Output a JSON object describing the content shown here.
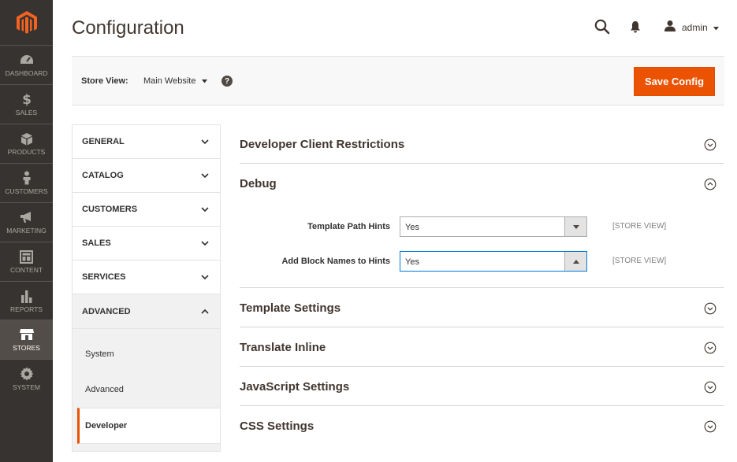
{
  "page": {
    "title": "Configuration"
  },
  "header": {
    "user": "admin"
  },
  "nav": {
    "items": [
      {
        "label": "DASHBOARD",
        "icon": "dashboard-icon"
      },
      {
        "label": "SALES",
        "icon": "dollar-icon"
      },
      {
        "label": "PRODUCTS",
        "icon": "box-icon"
      },
      {
        "label": "CUSTOMERS",
        "icon": "person-icon"
      },
      {
        "label": "MARKETING",
        "icon": "megaphone-icon"
      },
      {
        "label": "CONTENT",
        "icon": "layout-icon"
      },
      {
        "label": "REPORTS",
        "icon": "bar-chart-icon"
      },
      {
        "label": "STORES",
        "icon": "store-icon"
      },
      {
        "label": "SYSTEM",
        "icon": "gear-icon"
      }
    ]
  },
  "store_view": {
    "label": "Store View:",
    "value": "Main Website"
  },
  "actions": {
    "save_label": "Save Config"
  },
  "tabs": {
    "items": [
      {
        "label": "GENERAL"
      },
      {
        "label": "CATALOG"
      },
      {
        "label": "CUSTOMERS"
      },
      {
        "label": "SALES"
      },
      {
        "label": "SERVICES"
      },
      {
        "label": "ADVANCED"
      }
    ],
    "subitems": [
      {
        "label": "System"
      },
      {
        "label": "Advanced"
      },
      {
        "label": "Developer"
      }
    ]
  },
  "sections": {
    "client_restrictions": "Developer Client Restrictions",
    "debug": "Debug",
    "template_settings": "Template Settings",
    "translate_inline": "Translate Inline",
    "javascript_settings": "JavaScript Settings",
    "css_settings": "CSS Settings"
  },
  "debug": {
    "fields": [
      {
        "label": "Template Path Hints",
        "value": "Yes",
        "scope": "[STORE VIEW]"
      },
      {
        "label": "Add Block Names to Hints",
        "value": "Yes",
        "scope": "[STORE VIEW]"
      }
    ]
  },
  "colors": {
    "accent": "#eb5202",
    "nav_bg": "#373330",
    "focus": "#007bdb"
  }
}
